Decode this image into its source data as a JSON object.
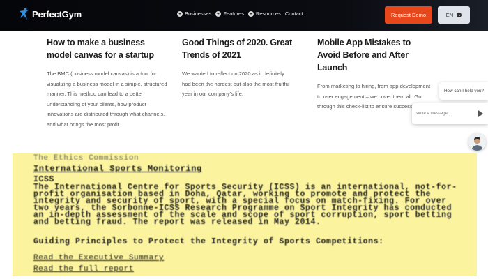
{
  "header": {
    "brand": "PerfectGym",
    "nav": [
      "Businesses",
      "Features",
      "Resources",
      "Contact"
    ],
    "cta": "Request Demo",
    "language": "EN"
  },
  "articles": [
    {
      "title": "How to make a business model canvas for a startup",
      "excerpt": "The BMC (business model canvas) is a tool for visualizing a business model in a simple, structured manner. This method can lead to a better understanding of your clients, how product innovations are distributed through what channels, and what brings the most profit."
    },
    {
      "title": "Good Things of 2020. Great Trends of 2021",
      "excerpt": "We wanted to reflect on 2020 as it definitely had been the hardest but also the most fruitful year in our company's life."
    },
    {
      "title": "Mobile App Mistakes to Avoid Before and After Launch",
      "excerpt": "From marketing to hiring, from app development to user engagement – we cover them all. Go through this check-list to ensure success!"
    }
  ],
  "chat": {
    "prompt": "How can I help you?",
    "placeholder": "Write a message..."
  },
  "highlight": {
    "faint_heading": "The Ethics Commission",
    "heading": "International Sports Monitoring",
    "org": "ICSS",
    "body": "The International Centre for Sports Security (ICSS) is an international, not-for-profit organisation based in Doha, Qatar, working to promote and protect the integrity and security of sport, with a special focus on match-fixing. For over two years, the Sorbonne-ICSS Research Programme on Sport Integrity has conducted an in-depth assessment of the scale and scope of sport corruption, sport betting and betting fraud. The report was released in May 2014.",
    "guiding": "Guiding Principles to Protect the Integrity of Sports Competitions:",
    "exec_link": "Read the Executive Summary",
    "full_link": "Read the full report"
  },
  "colors": {
    "header_bg": "#05060a",
    "cta_bg": "#e8471c",
    "highlight_bg": "#fbf39e"
  }
}
